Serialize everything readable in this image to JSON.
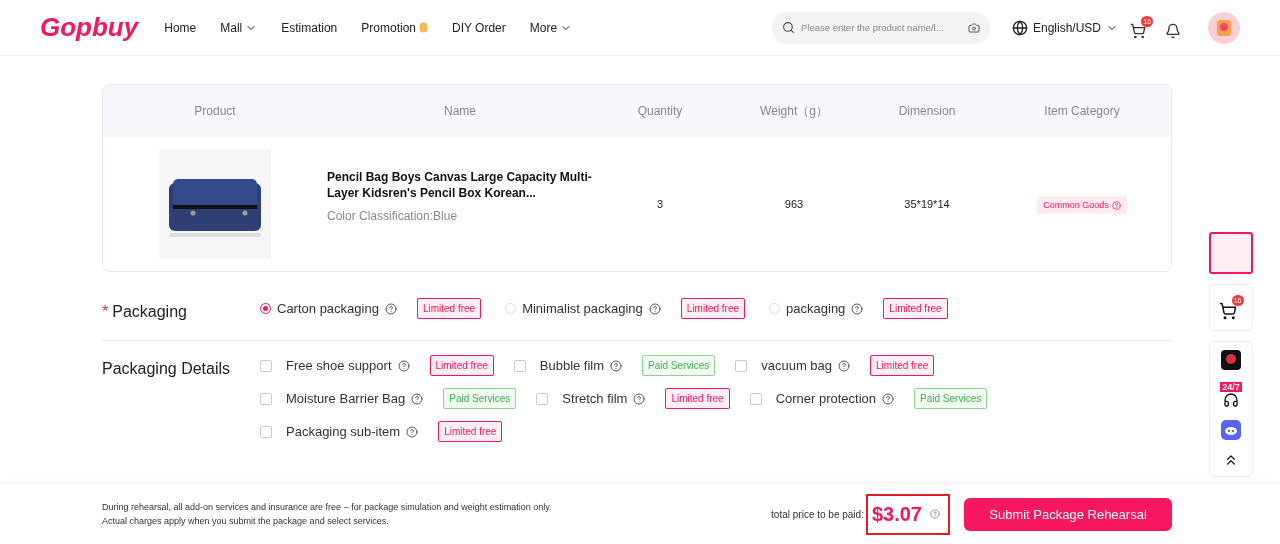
{
  "header": {
    "logo": "Gopbuy",
    "nav": [
      {
        "label": "Home",
        "dropdown": false,
        "hot": false
      },
      {
        "label": "Mall",
        "dropdown": true,
        "hot": false
      },
      {
        "label": "Estimation",
        "dropdown": false,
        "hot": false
      },
      {
        "label": "Promotion",
        "dropdown": false,
        "hot": true
      },
      {
        "label": "DIY Order",
        "dropdown": false,
        "hot": false
      },
      {
        "label": "More",
        "dropdown": true,
        "hot": false
      }
    ],
    "search": {
      "placeholder": "Please enter the product name/l..."
    },
    "language": "English/USD",
    "cart_count": "16"
  },
  "table": {
    "columns": [
      "Product",
      "Name",
      "Quantity",
      "Weight（g）",
      "Dimension",
      "Item Category"
    ],
    "rows": [
      {
        "name": "Pencil Bag Boys Canvas Large Capacity Multi-Layer Kidsren's Pencil Box Korean...",
        "variant": "Color Classification:Blue",
        "quantity": "3",
        "weight": "963",
        "dimension": "35*19*14",
        "category": "Common Goods"
      }
    ]
  },
  "packaging": {
    "required_mark": "*",
    "label": "Packaging",
    "options": [
      {
        "label": "Carton packaging",
        "selected": true,
        "badge": {
          "kind": "limited",
          "text": "Limited free"
        }
      },
      {
        "label": "Minimalist packaging",
        "selected": false,
        "badge": {
          "kind": "limited",
          "text": "Limited free"
        }
      },
      {
        "label": "packaging",
        "selected": false,
        "badge": {
          "kind": "limited",
          "text": "Limited free"
        }
      }
    ]
  },
  "packaging_details": {
    "label": "Packaging Details",
    "rows": [
      [
        {
          "label": "Free shoe support",
          "checked": false,
          "badge": {
            "kind": "limited",
            "text": "Limited free"
          }
        },
        {
          "label": "Bubble film",
          "checked": false,
          "badge": {
            "kind": "paid",
            "text": "Paid Services"
          }
        },
        {
          "label": "vacuum bag",
          "checked": false,
          "badge": {
            "kind": "limited",
            "text": "Limited free"
          }
        }
      ],
      [
        {
          "label": "Moisture Barrier Bag",
          "checked": false,
          "badge": {
            "kind": "paid",
            "text": "Paid Services"
          }
        },
        {
          "label": "Stretch film",
          "checked": false,
          "badge": {
            "kind": "limited",
            "text": "Limited free"
          }
        },
        {
          "label": "Corner protection",
          "checked": false,
          "badge": {
            "kind": "paid",
            "text": "Paid Services"
          }
        }
      ],
      [
        {
          "label": "Packaging sub-item",
          "checked": false,
          "badge": {
            "kind": "limited",
            "text": "Limited free"
          }
        }
      ]
    ]
  },
  "side_dock": {
    "cart_count": "16",
    "support_label": "24/7"
  },
  "footer": {
    "note": "During rehearsal, all add-on services and insurance are free – for package simulation and weight estimation only. Actual charges apply when you submit the package and select services.",
    "price_label": "total price to be paid:",
    "price": "$3.07",
    "submit": "Submit Package Rehearsal"
  }
}
